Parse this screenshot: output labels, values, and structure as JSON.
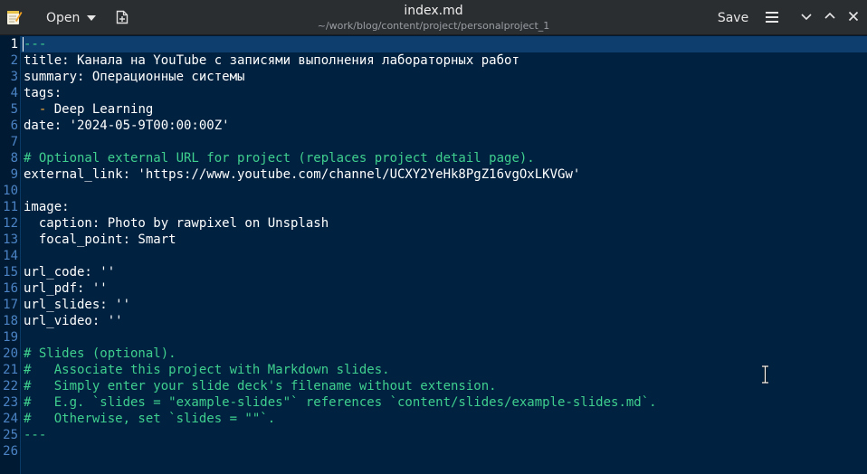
{
  "titlebar": {
    "open_label": "Open",
    "title": "index.md",
    "path": "~/work/blog/content/project/personalproject_1",
    "save_label": "Save"
  },
  "icons": {
    "app": "text-editor-icon",
    "open_caret": "chevron-down-icon",
    "new_document": "new-document-icon",
    "menu": "hamburger-menu-icon",
    "minimize": "chevron-down-icon",
    "maximize": "chevron-up-icon",
    "close": "close-icon"
  },
  "colors": {
    "background": "#002240",
    "gutter": "#001a33",
    "current_line": "#0e3e6e",
    "line_number": "#4b83c4",
    "comment": "#3fcf8e",
    "text": "#ffffff",
    "list_dash": "#ffad3a"
  },
  "editor": {
    "current_line": 1,
    "lines": [
      {
        "n": "1",
        "text": "---",
        "kind": "delim"
      },
      {
        "n": "2",
        "text": "title: Канала на YouTube с записями выполнения лабораторных работ",
        "kind": "text"
      },
      {
        "n": "3",
        "text": "summary: Операционные системы",
        "kind": "text"
      },
      {
        "n": "4",
        "text": "tags:",
        "kind": "text"
      },
      {
        "n": "5",
        "text": "Deep Learning",
        "kind": "list"
      },
      {
        "n": "6",
        "text": "date: '2024-05-9T00:00:00Z'",
        "kind": "text"
      },
      {
        "n": "7",
        "text": "",
        "kind": "text"
      },
      {
        "n": "8",
        "text": "# Optional external URL for project (replaces project detail page).",
        "kind": "comment"
      },
      {
        "n": "9",
        "text": "external_link: 'https://www.youtube.com/channel/UCXY2YeHk8PgZ16vgOxLKVGw'",
        "kind": "text"
      },
      {
        "n": "10",
        "text": "",
        "kind": "text"
      },
      {
        "n": "11",
        "text": "image:",
        "kind": "text"
      },
      {
        "n": "12",
        "text": "  caption: Photo by rawpixel on Unsplash",
        "kind": "text"
      },
      {
        "n": "13",
        "text": "  focal_point: Smart",
        "kind": "text"
      },
      {
        "n": "14",
        "text": "",
        "kind": "text"
      },
      {
        "n": "15",
        "text": "url_code: ''",
        "kind": "text"
      },
      {
        "n": "16",
        "text": "url_pdf: ''",
        "kind": "text"
      },
      {
        "n": "17",
        "text": "url_slides: ''",
        "kind": "text"
      },
      {
        "n": "18",
        "text": "url_video: ''",
        "kind": "text"
      },
      {
        "n": "19",
        "text": "",
        "kind": "text"
      },
      {
        "n": "20",
        "text": "# Slides (optional).",
        "kind": "comment"
      },
      {
        "n": "21",
        "text": "#   Associate this project with Markdown slides.",
        "kind": "comment"
      },
      {
        "n": "22",
        "text": "#   Simply enter your slide deck's filename without extension.",
        "kind": "comment"
      },
      {
        "n": "23",
        "text": "#   E.g. `slides = \"example-slides\"` references `content/slides/example-slides.md`.",
        "kind": "comment"
      },
      {
        "n": "24",
        "text": "#   Otherwise, set `slides = \"\"`.",
        "kind": "comment"
      },
      {
        "n": "25",
        "text": "---",
        "kind": "delim"
      },
      {
        "n": "26",
        "text": "",
        "kind": "text"
      }
    ],
    "list_dash": "-"
  }
}
